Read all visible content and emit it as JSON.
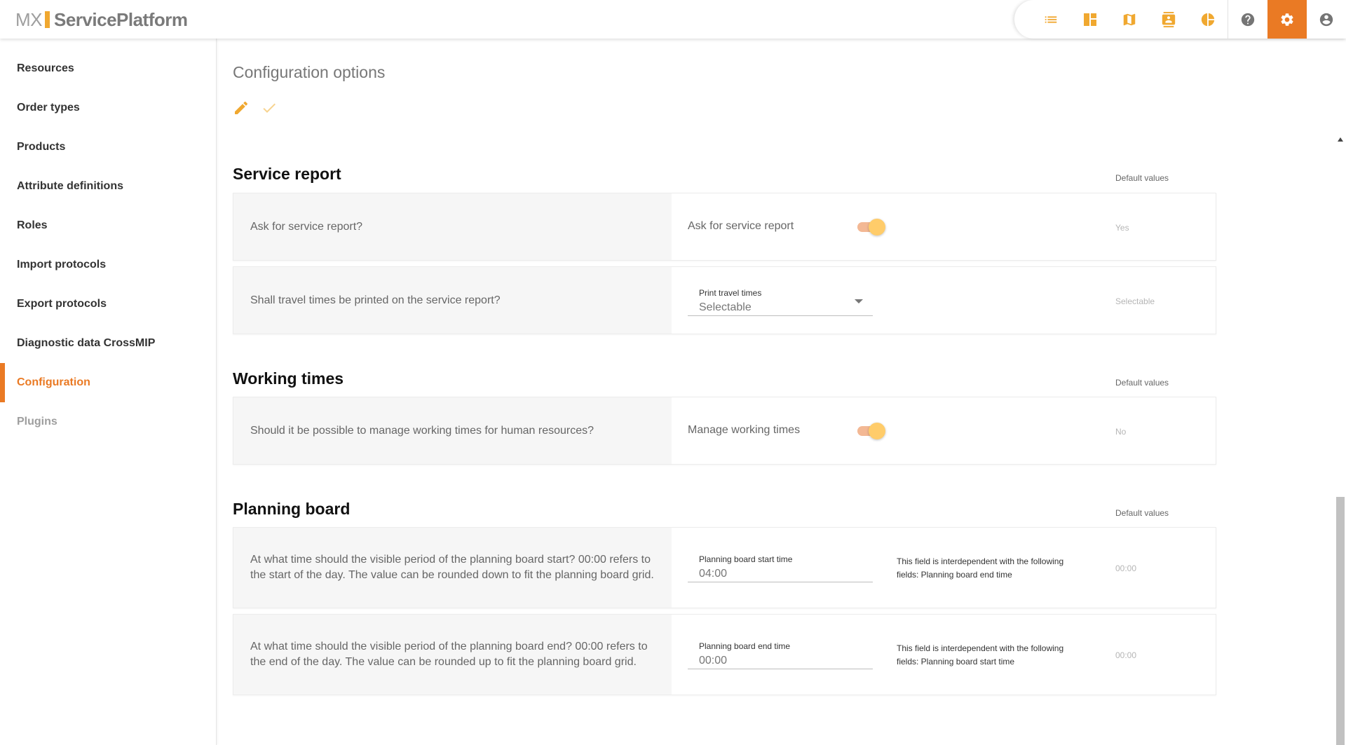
{
  "app": {
    "logo_prefix": "MX",
    "logo_name": "ServicePlatform"
  },
  "topnav": {
    "items": [
      {
        "icon": "list-icon"
      },
      {
        "icon": "dashboard-icon"
      },
      {
        "icon": "map-icon"
      },
      {
        "icon": "contacts-icon"
      },
      {
        "icon": "pie-chart-icon"
      },
      {
        "icon": "help-icon"
      },
      {
        "icon": "settings-icon",
        "active": true
      },
      {
        "icon": "account-icon"
      }
    ],
    "accent_color": "#ea7a24",
    "icon_color": "#f0a830"
  },
  "sidebar": {
    "items": [
      {
        "label": "Resources"
      },
      {
        "label": "Order types"
      },
      {
        "label": "Products"
      },
      {
        "label": "Attribute definitions"
      },
      {
        "label": "Roles"
      },
      {
        "label": "Import protocols"
      },
      {
        "label": "Export protocols"
      },
      {
        "label": "Diagnostic data CrossMIP"
      },
      {
        "label": "Configuration",
        "active": true
      },
      {
        "label": "Plugins",
        "disabled": true
      }
    ]
  },
  "main": {
    "title": "Configuration options",
    "actions": {
      "edit_icon": "pencil-icon",
      "save_icon": "check-icon"
    },
    "default_values_label": "Default values",
    "sections": {
      "service_report": {
        "title": "Service report",
        "rows": [
          {
            "question": "Ask for service report?",
            "control_label": "Ask for service report",
            "control_state": "on",
            "default": "Yes"
          },
          {
            "question": "Shall travel times be printed on the service report?",
            "field_label": "Print travel times",
            "field_value": "Selectable",
            "default": "Selectable"
          }
        ]
      },
      "working_times": {
        "title": "Working times",
        "rows": [
          {
            "question": "Should it be possible to manage working times for human resources?",
            "control_label": "Manage working times",
            "control_state": "on",
            "default": "No"
          }
        ]
      },
      "planning_board": {
        "title": "Planning board",
        "rows": [
          {
            "question": "At what time should the visible period of the planning board start? 00:00 refers to the start of the day. The value can be rounded down to fit the planning board grid.",
            "field_label": "Planning board start time",
            "field_value": "04:00",
            "note": "This field is interdependent with the following fields: Planning board end time",
            "default": "00:00"
          },
          {
            "question": "At what time should the visible period of the planning board end? 00:00 refers to the end of the day. The value can be rounded up to fit the planning board grid.",
            "field_label": "Planning board end time",
            "field_value": "00:00",
            "note": "This field is interdependent with the following fields: Planning board start time",
            "default": "00:00"
          }
        ]
      }
    }
  }
}
